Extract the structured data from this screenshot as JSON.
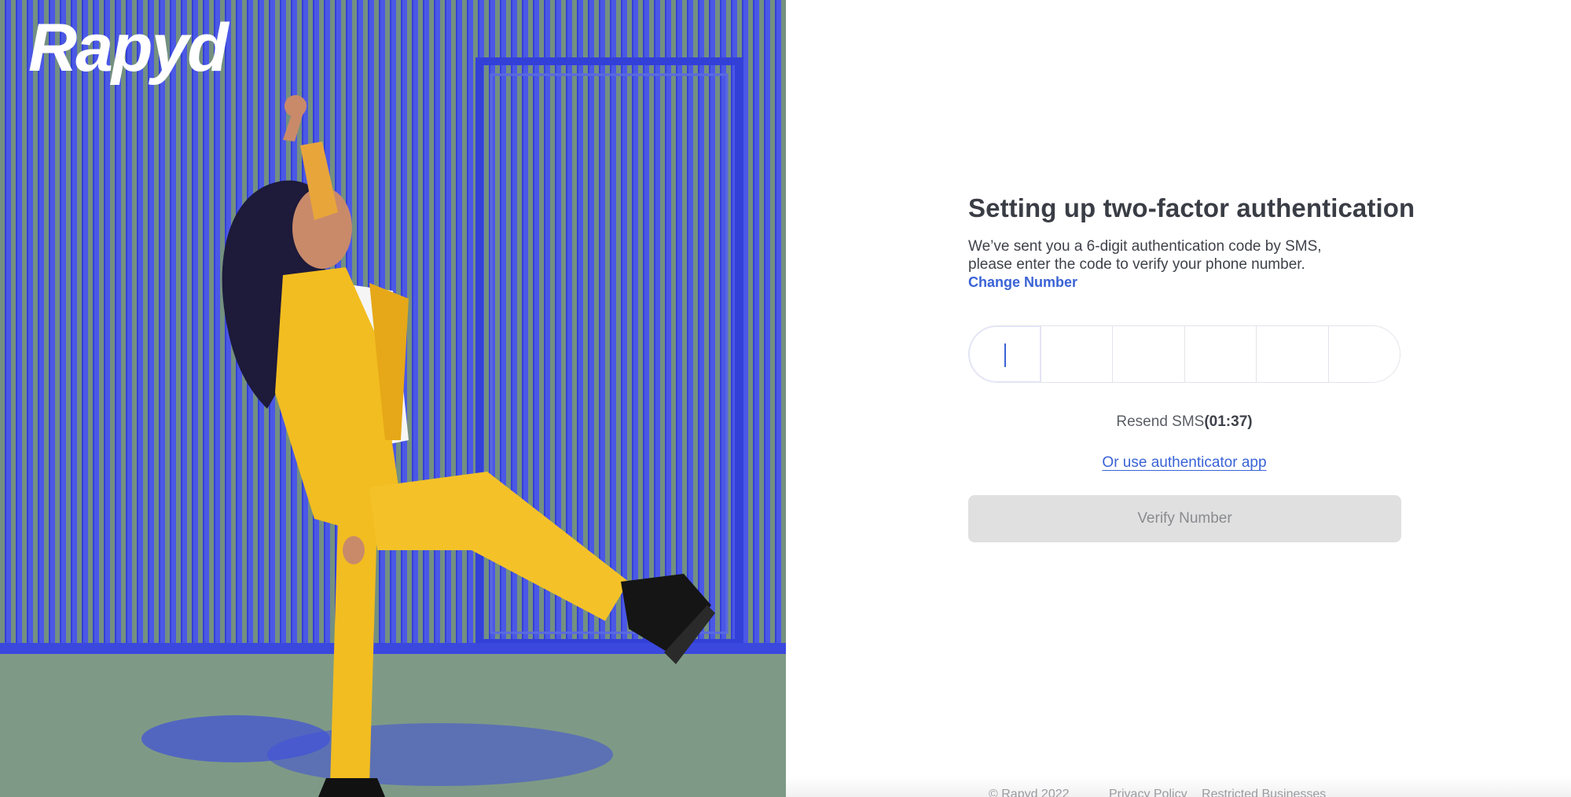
{
  "brand": {
    "logo_text": "Rapyd"
  },
  "colors": {
    "accent": "#3a63d6",
    "hero_blue": "#4a56e8",
    "hero_yellow": "#f2c21a",
    "button_disabled_bg": "#e0e0e0",
    "title_text": "#3a3d45"
  },
  "auth": {
    "title": "Setting up two-factor authentication",
    "desc_line1": "We’ve sent you a 6-digit authentication code by SMS,",
    "desc_line2": "please enter the code to verify your phone number.",
    "change_number": "Change Number",
    "otp_cells": [
      "",
      "",
      "",
      "",
      "",
      ""
    ],
    "resend_label": "Resend SMS",
    "resend_timer": "(01:37)",
    "auth_app_link": "Or use authenticator app",
    "verify_button": "Verify Number"
  },
  "footer": {
    "copyright": "© Rapyd 2022",
    "privacy": "Privacy Policy",
    "restricted": "Restricted Businesses"
  }
}
